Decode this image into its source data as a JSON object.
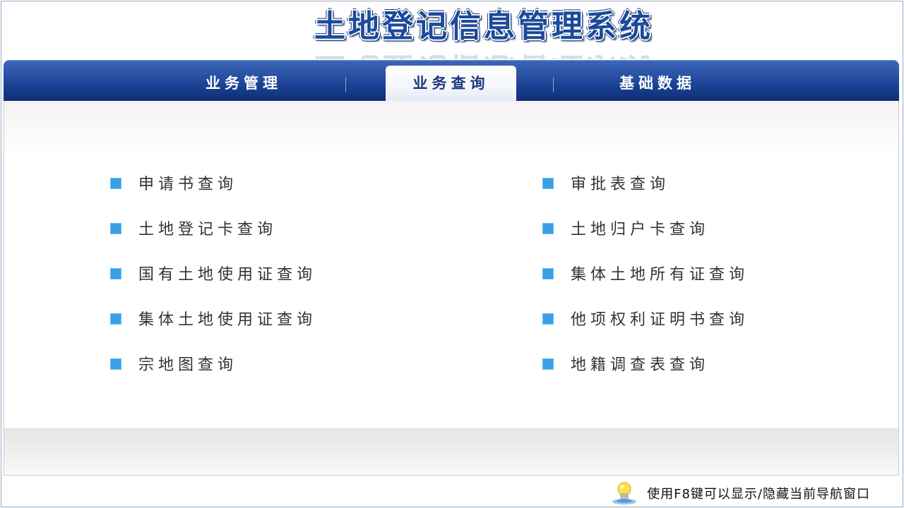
{
  "app": {
    "title": "土地登记信息管理系统"
  },
  "nav": {
    "tabs": [
      {
        "label": "业务管理",
        "active": false
      },
      {
        "label": "业务查询",
        "active": true
      },
      {
        "label": "基础数据",
        "active": false
      }
    ]
  },
  "queries": {
    "left": [
      "申请书查询",
      "土地登记卡查询",
      "国有土地使用证查询",
      "集体土地使用证查询",
      "宗地图查询"
    ],
    "right": [
      "审批表查询",
      "土地归户卡查询",
      "集体土地所有证查询",
      "他项权利证明书查询",
      "地籍调查表查询"
    ]
  },
  "footer": {
    "hint": "使用F8键可以显示/隐藏当前导航窗口",
    "icon": "lightbulb-icon"
  },
  "colors": {
    "nav_blue": "#173d8d",
    "bullet_blue": "#3aa0e6",
    "title_blue": "#1b4a9a"
  }
}
